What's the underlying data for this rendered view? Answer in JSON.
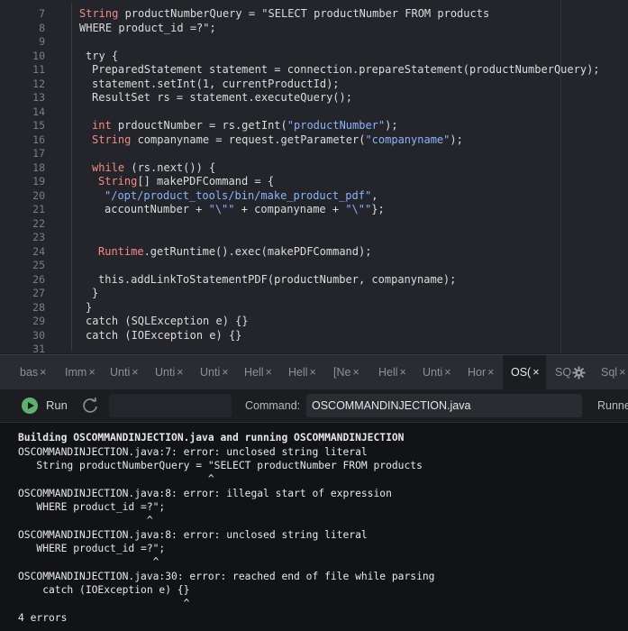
{
  "editor": {
    "line_numbers": [
      "7",
      "8",
      "9",
      "10",
      "11",
      "12",
      "13",
      "14",
      "15",
      "16",
      "17",
      "18",
      "19",
      "20",
      "21",
      "22",
      "23",
      "24",
      "25",
      "26",
      "27",
      "28",
      "29",
      "30",
      "31"
    ],
    "code": {
      "l7_type": "String",
      "l7_rest": " productNumberQuery = \"SELECT productNumber FROM products",
      "l8": "WHERE product_id =?\";",
      "l10": "try {",
      "l11": "PreparedStatement statement = connection.prepareStatement(productNumberQuery);",
      "l12": "statement.setInt(1, currentProductId);",
      "l13": "ResultSet rs = statement.executeQuery();",
      "l15_type": "int",
      "l15_a": " prdouctNumber = rs.getInt(",
      "l15_str": "\"productNumber\"",
      "l15_b": ");",
      "l16_type": "String",
      "l16_a": " companyname = request.getParameter(",
      "l16_str": "\"companyname\"",
      "l16_b": ");",
      "l18_kw": "while",
      "l18_rest": " (rs.next()) {",
      "l19_type": "String",
      "l19_rest": "[] makePDFCommand = {",
      "l20_str": "\"/opt/product_tools/bin/make_product_pdf\"",
      "l20_rest": ",",
      "l21_a": "accountNumber + ",
      "l21_s1": "\"\\\"\"",
      "l21_b": " + companyname + ",
      "l21_s2": "\"\\\"\"",
      "l21_c": "};",
      "l24_type": "Runtime",
      "l24_rest": ".getRuntime().exec(makePDFCommand);",
      "l26": "this.addLinkToStatementPDF(productNumber, companyname);",
      "l27": "}",
      "l28": "}",
      "l29": "catch (SQLException e) {}",
      "l30": "catch (IOException e) {}"
    }
  },
  "tabs": [
    {
      "label": "bas",
      "close": "×"
    },
    {
      "label": "Imm",
      "close": "×"
    },
    {
      "label": "Unti",
      "close": "×"
    },
    {
      "label": "Unti",
      "close": "×"
    },
    {
      "label": "Unti",
      "close": "×"
    },
    {
      "label": "Hell",
      "close": "×"
    },
    {
      "label": "Hell",
      "close": "×"
    },
    {
      "label": "[Ne",
      "close": "×"
    },
    {
      "label": "Hell",
      "close": "×"
    },
    {
      "label": "Unti",
      "close": "×"
    },
    {
      "label": "Hor",
      "close": "×"
    },
    {
      "label": "OS(",
      "close": "×",
      "active": true
    },
    {
      "label": "SQ",
      "close": ""
    },
    {
      "label": "Sql",
      "close": "×"
    }
  ],
  "runbar": {
    "run_label": "Run",
    "command_label": "Command:",
    "command_value": "OSCOMMANDINJECTION.java",
    "runner_label": "Runne"
  },
  "console": {
    "lines": [
      "Building OSCOMMANDINJECTION.java and running OSCOMMANDINJECTION",
      "OSCOMMANDINJECTION.java:7: error: unclosed string literal",
      "   String productNumberQuery = \"SELECT productNumber FROM products",
      "                               ^",
      "OSCOMMANDINJECTION.java:8: error: illegal start of expression",
      "   WHERE product_id =?\";",
      "                     ^",
      "OSCOMMANDINJECTION.java:8: error: unclosed string literal",
      "   WHERE product_id =?\";",
      "                      ^",
      "OSCOMMANDINJECTION.java:30: error: reached end of file while parsing",
      "    catch (IOException e) {}",
      "                           ^",
      "4 errors"
    ]
  },
  "colors": {
    "keyword": "#f28b82",
    "string": "#8ab4f8",
    "run_green": "#5db06e"
  }
}
